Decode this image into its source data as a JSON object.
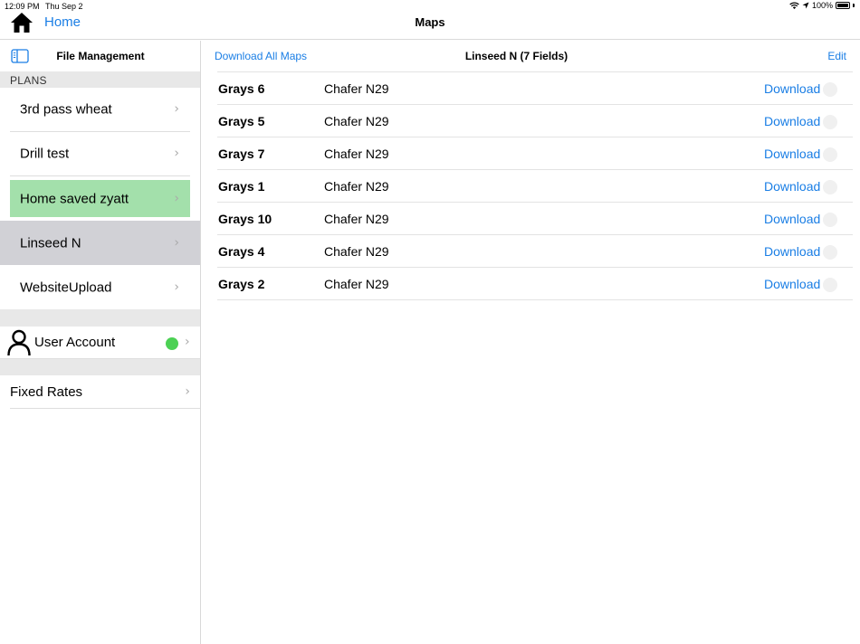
{
  "status_bar": {
    "time": "12:09 PM",
    "date": "Thu Sep 2",
    "battery": "100%"
  },
  "nav": {
    "home_label": "Home",
    "title": "Maps"
  },
  "sidebar": {
    "title": "File Management",
    "section_label": "PLANS",
    "plans": [
      {
        "label": "3rd pass wheat"
      },
      {
        "label": "Drill test"
      },
      {
        "label": "Home saved zyatt"
      },
      {
        "label": "Linseed N"
      },
      {
        "label": "WebsiteUpload"
      }
    ],
    "account_label": "User Account",
    "account_status_color": "#4cd154",
    "fixed_rates_label": "Fixed Rates"
  },
  "main": {
    "download_all_label": "Download All Maps",
    "title": "Linseed N (7 Fields)",
    "edit_label": "Edit",
    "fields": [
      {
        "name": "Grays 6",
        "product": "Chafer N29",
        "action": "Download"
      },
      {
        "name": "Grays 5",
        "product": "Chafer N29",
        "action": "Download"
      },
      {
        "name": "Grays 7",
        "product": "Chafer N29",
        "action": "Download"
      },
      {
        "name": "Grays 1",
        "product": "Chafer N29",
        "action": "Download"
      },
      {
        "name": "Grays 10",
        "product": "Chafer N29",
        "action": "Download"
      },
      {
        "name": "Grays 4",
        "product": "Chafer N29",
        "action": "Download"
      },
      {
        "name": "Grays 2",
        "product": "Chafer N29",
        "action": "Download"
      }
    ]
  },
  "colors": {
    "accent": "#1a7ee5",
    "saved_highlight": "#a3e0ab",
    "selected_row": "#d1d1d6"
  }
}
